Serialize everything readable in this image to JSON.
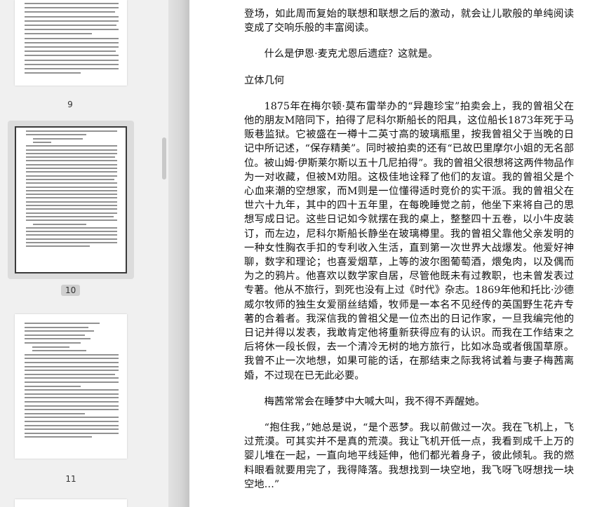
{
  "thumbnails": [
    {
      "page": "9"
    },
    {
      "page": "10"
    },
    {
      "page": "11"
    }
  ],
  "document": {
    "paragraphs": [
      "登场，如此周而复始的联想和联想之后的激动，就会让儿歌般的单纯阅读变成了交响乐般的丰富阅读。",
      "什么是伊恩·麦克尤恩后遗症？这就是。",
      "立体几何",
      "1875年在梅尔顿·莫布雷举办的“异趣珍宝”拍卖会上，我的曾祖父在他的朋友M陪同下，拍得了尼科尔斯船长的阳具，这位船长1873年死于马贩巷监狱。它被盛在一樽十二英寸高的玻璃瓶里，按我曾祖父于当晚的日记中所记述，“保存精美”。同时被拍卖的还有“已故巴里摩尔小姐的无名部位。被山姆·伊斯莱尔斯以五十几尼拍得”。我的曾祖父很想将这两件物品作为一对收藏，但被M劝阻。这极佳地诠释了他们的友谊。我的曾祖父是个心血来潮的空想家，而M则是一位懂得适时竞价的实干派。我的曾祖父在世六十九年，其中的四十五年里，在每晚睡觉之前，他坐下来将自己的思想写成日记。这些日记如今就摆在我的桌上，整整四十五卷，以小牛皮装订，而左边，尼科尔斯船长静坐在玻璃樽里。我的曾祖父靠他父亲发明的一种女性胸衣手扣的专利收入生活，直到第一次世界大战爆发。他爱好神聊，数字和理论；也喜爱烟草，上等的波尔图葡萄酒，煨兔肉，以及偶而为之的鸦片。他喜欢以数学家自居，尽管他既未有过教职，也未曾发表过专著。他从不旅行，到死也没有上过《时代》杂志。1869年他和托比·沙德威尔牧师的独生女爱丽丝结婚，牧师是一本名不见经传的英国野生花卉专著的合着者。我深信我的曾祖父是一位杰出的日记作家，一旦我编完他的日记并得以发表，我敢肯定他将重新获得应有的认识。而我在工作结束之后将休一段长假，去一个清冷无树的地方旅行，比如冰岛或者俄国草原。我曾不止一次地想，如果可能的话，在那结束之际我将试着与妻子梅茜离婚，不过现在已无此必要。",
      "梅茜常常会在睡梦中大喊大叫，我不得不弄醒她。",
      "“抱住我，”她总是说，“是个恶梦。我以前做过一次。我在飞机上，飞过荒漠。可其实并不是真的荒漠。我让飞机开低一点，我看到成千上万的婴儿堆在一起，一直向地平线延伸，他们都光着身子，彼此倾轧。我的燃料眼看就要用完了，我得降落。我想找到一块空地，我飞呀飞呀想找一块空地…”"
    ]
  }
}
